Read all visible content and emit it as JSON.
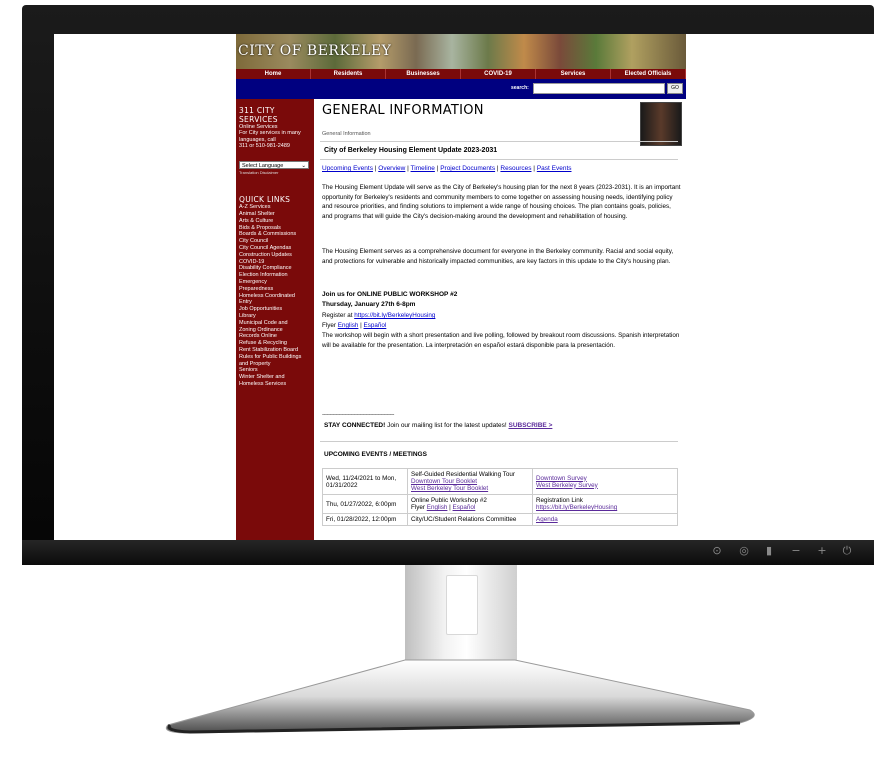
{
  "site": {
    "logo": "CITY OF BERKELEY",
    "nav": [
      "Home",
      "Residents",
      "Businesses",
      "COVID-19",
      "Services",
      "Elected Officials"
    ],
    "search_label": "search:",
    "search_go": "GO"
  },
  "sidebar": {
    "service_head": "311 CITY SERVICES",
    "service_lines": [
      "Online Services",
      "For City services in many",
      "languages, call",
      "311 or 510-981-2489"
    ],
    "language_select": "Select Language",
    "translation_disclaimer": "Translation Disclaimer",
    "quick_head": "QUICK LINKS",
    "quick_links": [
      "A-Z Services",
      "Animal Shelter",
      "Arts & Culture",
      "Bids & Proposals",
      "Boards & Commissions",
      "City Council",
      "City Council Agendas",
      "Construction Updates",
      "COVID-19",
      "Disability Compliance",
      "Election Information",
      "Emergency",
      "Preparedness",
      "Homeless Coordinated",
      "Entry",
      "Job Opportunities",
      "Library",
      "Municipal Code and",
      "Zoning Ordinance",
      "Records Online",
      "Refuse & Recycling",
      "Rent Stabilization Board",
      "Rules for Public Buildings",
      "and Property",
      "Seniors",
      "Winter Shelter and",
      "Homeless Services"
    ]
  },
  "main": {
    "title": "GENERAL INFORMATION",
    "breadcrumb": "General Information",
    "subtitle": "City of Berkeley Housing Element Update 2023-2031",
    "anchors": [
      "Upcoming Events",
      "Overview",
      "Timeline",
      "Project Documents",
      "Resources",
      "Past Events"
    ],
    "para1": "The Housing Element Update will serve as the City of Berkeley's housing plan for the next 8 years (2023-2031). It is an important opportunity for Berkeley's residents and community members to come together on assessing housing needs, identifying policy and resource priorities, and finding solutions to implement a wide range of housing choices. The plan contains goals, policies, and programs that will guide the City's decision-making around the development and rehabilitation of housing.",
    "para2": "The Housing Element serves as a comprehensive document for everyone in the Berkeley community. Racial and social equity, and protections for vulnerable and historically impacted communities, are key factors in this update to the City's housing plan.",
    "workshop_head1": "Join us for ONLINE PUBLIC WORKSHOP #2",
    "workshop_head2": "Thursday, January 27th 6-8pm",
    "register_prefix": "Register at ",
    "register_link": "https://bit.ly/BerkeleyHousing",
    "flyer_prefix": "Flyer ",
    "flyer_en": "English",
    "flyer_es": "Español",
    "workshop_desc": "The workshop will begin with a short presentation and live polling, followed by breakout room discussions. Spanish interpretation will be available for the presentation. La interpretación en español estará disponible para la presentación.",
    "dashes": "------------------------------------------------",
    "stay_bold": "STAY CONNECTED!",
    "stay_text": " Join our mailing list for the latest updates! ",
    "subscribe": "SUBSCRIBE >",
    "events_head": "UPCOMING EVENTS / MEETINGS",
    "events": [
      {
        "date": "Wed, 11/24/2021 to Mon, 01/31/2022",
        "desc": "Self-Guided Residential Walking Tour",
        "desc_links": [
          "Downtown Tour Booklet",
          "West Berkeley Tour Booklet"
        ],
        "links": [
          "Downtown Survey",
          "West Berkeley Survey"
        ]
      },
      {
        "date": "Thu, 01/27/2022, 6:00pm",
        "desc": "Online Public Workshop #2",
        "desc_links": [
          "English",
          "Español"
        ],
        "links_label": "Registration Link",
        "links": [
          "https://bit.ly/BerkeleyHousing"
        ]
      },
      {
        "date": "Fri, 01/28/2022, 12:00pm",
        "desc": "City/UC/Student Relations Committee",
        "desc_links": [],
        "links": [
          "Agenda"
        ]
      }
    ]
  },
  "monitor": {
    "buttons": [
      "input-icon",
      "menu-icon",
      "brightness-icon",
      "minus-icon",
      "plus-icon",
      "power-icon"
    ]
  }
}
